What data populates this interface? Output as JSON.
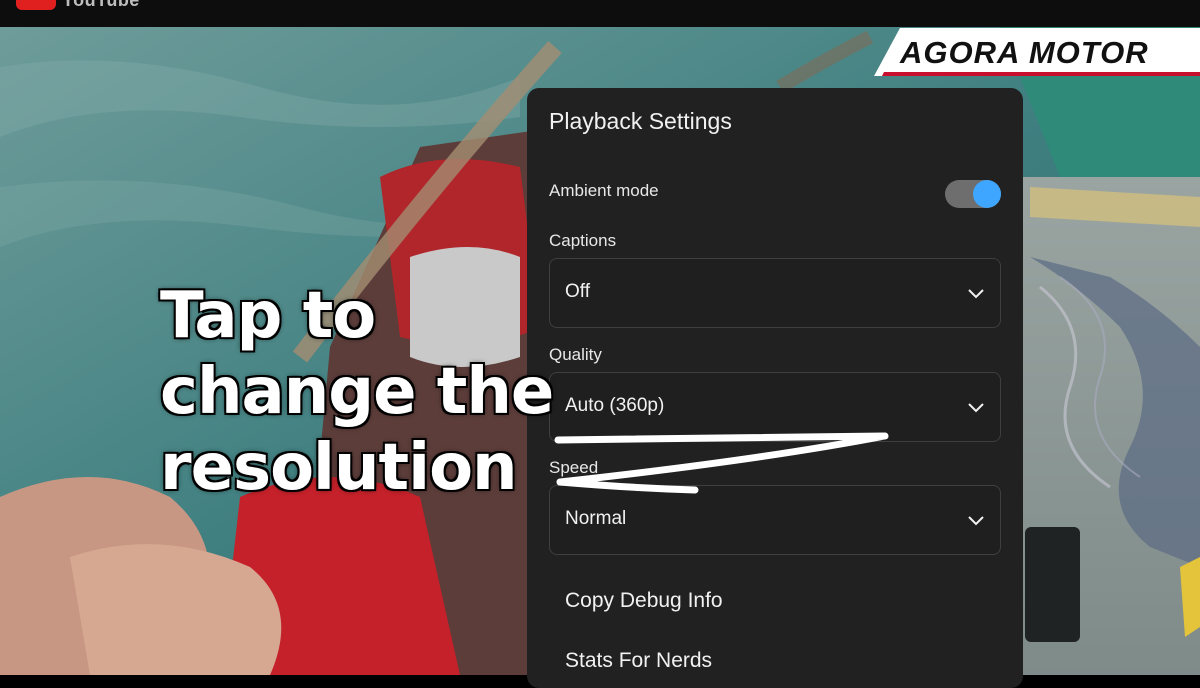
{
  "app": {
    "name": "YouTube",
    "brand": "AGORA MOTOR"
  },
  "overlay": {
    "caption_lines": [
      "Tap to",
      "change the",
      "resolution"
    ]
  },
  "settings": {
    "title": "Playback Settings",
    "ambient_mode": {
      "label": "Ambient mode",
      "enabled": true
    },
    "captions": {
      "label": "Captions",
      "value": "Off"
    },
    "quality": {
      "label": "Quality",
      "value": "Auto (360p)"
    },
    "speed": {
      "label": "Speed",
      "value": "Normal"
    },
    "menu": [
      "Copy Debug Info",
      "Stats For Nerds"
    ]
  },
  "colors": {
    "panel_bg": "#212121",
    "toggle_on": "#3ea6ff",
    "brand_red": "#c8102e"
  },
  "icons": [
    "youtube-logo-icon",
    "chevron-down-icon",
    "tire-icon"
  ]
}
